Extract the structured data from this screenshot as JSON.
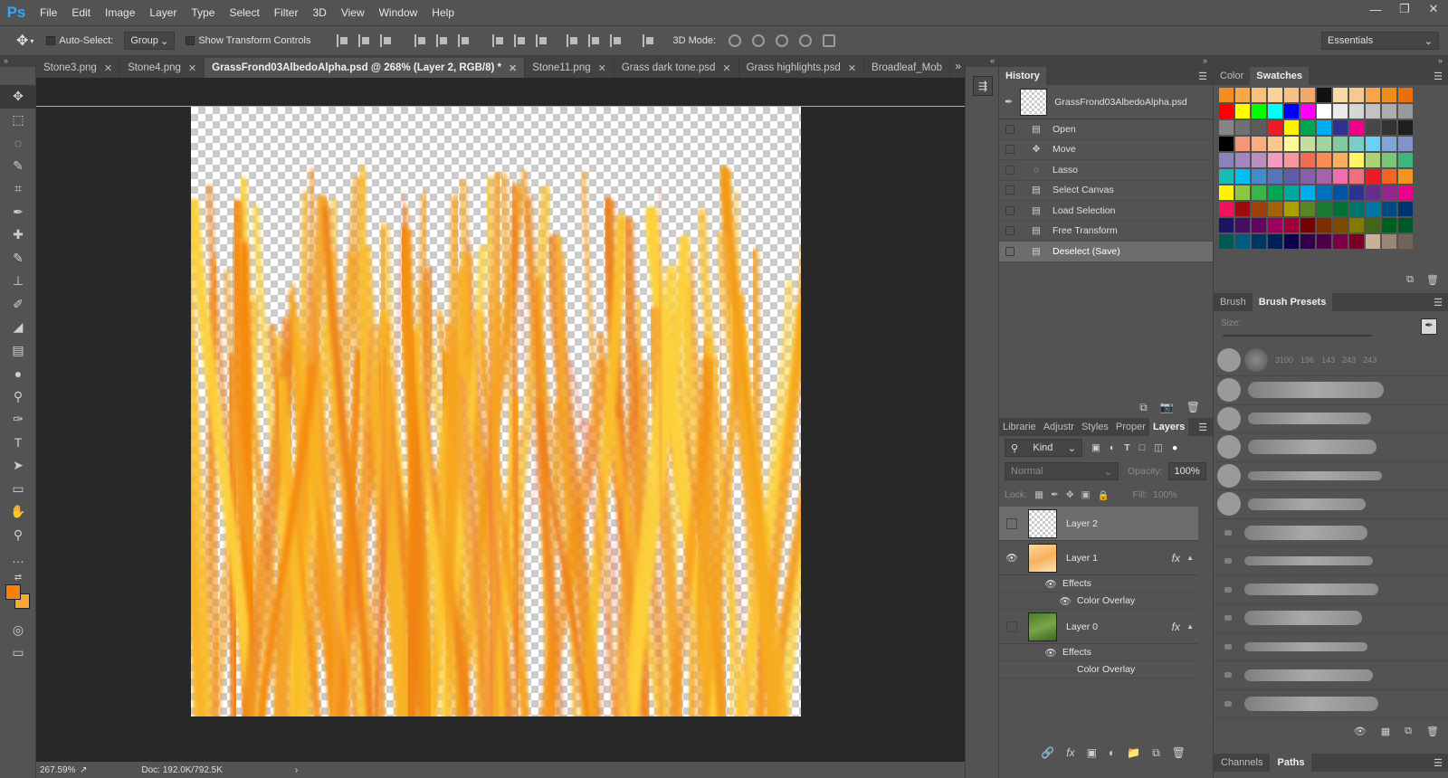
{
  "app": {
    "logo": "Ps",
    "menu": [
      "File",
      "Edit",
      "Image",
      "Layer",
      "Type",
      "Select",
      "Filter",
      "3D",
      "View",
      "Window",
      "Help"
    ],
    "window_controls": [
      "minimize-icon",
      "restore-icon",
      "close-icon"
    ]
  },
  "options_bar": {
    "tool_icon": "move-icon",
    "auto_select_label": "Auto-Select:",
    "auto_select_value": "Group",
    "show_transform_label": "Show Transform Controls",
    "mode_3d_label": "3D Mode:",
    "workspace_value": "Essentials"
  },
  "tools": [
    "move-tool",
    "marquee-tool",
    "lasso-tool",
    "quick-selection-tool",
    "crop-tool",
    "eyedropper-tool",
    "healing-brush-tool",
    "brush-tool",
    "clone-stamp-tool",
    "history-brush-tool",
    "eraser-tool",
    "gradient-tool",
    "blur-tool",
    "dodge-tool",
    "pen-tool",
    "type-tool",
    "path-selection-tool",
    "rectangle-tool",
    "hand-tool",
    "zoom-tool",
    "edit-toolbar-tool"
  ],
  "colors": {
    "foreground": "#f7800a",
    "background": "#f6a836",
    "accent_guide": "#4fd6e8"
  },
  "tabs": [
    {
      "label": "Stone3.png",
      "active": false
    },
    {
      "label": "Stone4.png",
      "active": false
    },
    {
      "label": "GrassFrond03AlbedoAlpha.psd @ 268% (Layer 2, RGB/8) *",
      "active": true
    },
    {
      "label": "Stone11.png",
      "active": false
    },
    {
      "label": "Grass dark tone.psd",
      "active": false
    },
    {
      "label": "Grass highlights.psd",
      "active": false
    },
    {
      "label": "Broadleaf_Mob",
      "active": false
    }
  ],
  "status": {
    "zoom": "267.59%",
    "doc": "Doc: 192.0K/792.5K"
  },
  "history": {
    "title": "History",
    "snapshot_name": "GrassFrond03AlbedoAlpha.psd",
    "items": [
      {
        "label": "Open",
        "icon": "document-icon"
      },
      {
        "label": "Move",
        "icon": "move-icon"
      },
      {
        "label": "Lasso",
        "icon": "lasso-icon"
      },
      {
        "label": "Select Canvas",
        "icon": "document-icon"
      },
      {
        "label": "Load Selection",
        "icon": "document-icon"
      },
      {
        "label": "Free Transform",
        "icon": "document-icon"
      },
      {
        "label": "Deselect (Save)",
        "icon": "document-icon",
        "selected": true
      }
    ]
  },
  "layers_panel": {
    "tabs": [
      "Librarie",
      "Adjustr",
      "Styles",
      "Proper",
      "Layers"
    ],
    "filter_label": "Kind",
    "blend_mode": "Normal",
    "opacity_label": "Opacity:",
    "opacity_value": "100%",
    "lock_label": "Lock:",
    "fill_label": "Fill:",
    "fill_value": "100%",
    "layers": [
      {
        "name": "Layer 2",
        "visible": false,
        "selected": true,
        "fx": false
      },
      {
        "name": "Layer 1",
        "visible": true,
        "selected": false,
        "fx": true,
        "effects_label": "Effects",
        "effect": "Color Overlay"
      },
      {
        "name": "Layer 0",
        "visible": false,
        "selected": false,
        "fx": true,
        "effects_label": "Effects",
        "effect": "Color Overlay"
      }
    ],
    "fx_label": "fx"
  },
  "swatches_panel": {
    "tabs": [
      "Color",
      "Swatches"
    ],
    "top_row": [
      "#f58c1e",
      "#f7a84a",
      "#f8c27b",
      "#f9d19b",
      "#f6c087",
      "#f3a86a",
      "#111111",
      "#f9d9a6",
      "#f8c98c",
      "#f5a64b",
      "#f08c1c",
      "#e96f0c"
    ],
    "grid": [
      "#ff0000",
      "#ffff00",
      "#00ff00",
      "#00ffff",
      "#0000ff",
      "#ff00ff",
      "#ffffff",
      "#ebebeb",
      "#d6d6d6",
      "#c2c2c2",
      "#adadad",
      "#999999",
      "#858585",
      "#707070",
      "#5c5c5c",
      "#ed1c24",
      "#fff200",
      "#00a651",
      "#00aeef",
      "#2e3192",
      "#ec008c",
      "#474747",
      "#333333",
      "#1f1f1f",
      "#000000",
      "#f7977a",
      "#f9ad81",
      "#fdc68a",
      "#fff79a",
      "#c4df9b",
      "#a3d39c",
      "#82ca9d",
      "#7bcdc8",
      "#6ecff6",
      "#7ea7d8",
      "#8493ca",
      "#8882be",
      "#a187be",
      "#bc8dbf",
      "#f49ac2",
      "#f6989d",
      "#f26c4f",
      "#f68e55",
      "#fbaf5c",
      "#fff467",
      "#acd372",
      "#7cc576",
      "#3bb878",
      "#1abbb4",
      "#00bff3",
      "#438ccb",
      "#5574b9",
      "#605ca8",
      "#855fa8",
      "#a763a8",
      "#f06ea9",
      "#f26d7d",
      "#ed1c24",
      "#f26522",
      "#f7941d",
      "#fff200",
      "#8dc73f",
      "#39b54a",
      "#00a651",
      "#00a99d",
      "#00aeef",
      "#0072bc",
      "#0054a6",
      "#2e3192",
      "#662d91",
      "#92278f",
      "#ec008c",
      "#ed145b",
      "#9e0b0f",
      "#a0410d",
      "#a36209",
      "#aba000",
      "#598527",
      "#197b30",
      "#007236",
      "#00746b",
      "#0076a3",
      "#004b80",
      "#003471"
    ],
    "bottom_row": [
      "#1b1464",
      "#440e62",
      "#630460",
      "#9e005d",
      "#9e0039",
      "#790000",
      "#7b2e00",
      "#7d4900",
      "#827b00",
      "#406618",
      "#005e20",
      "#005826"
    ],
    "last_row": [
      "#005952",
      "#005b7f",
      "#003663",
      "#002157",
      "#0d004c",
      "#32004b",
      "#4b0049",
      "#7b0046",
      "#7a0026",
      "#c7b299",
      "#998675",
      "#736357"
    ]
  },
  "brush_panel": {
    "tabs": [
      "Brush",
      "Brush Presets"
    ],
    "size_label": "Size:",
    "preset_numbers": [
      "3100",
      "196",
      "143",
      "243",
      "243"
    ]
  },
  "bottom_panel": {
    "tabs": [
      "Channels",
      "Paths"
    ]
  }
}
